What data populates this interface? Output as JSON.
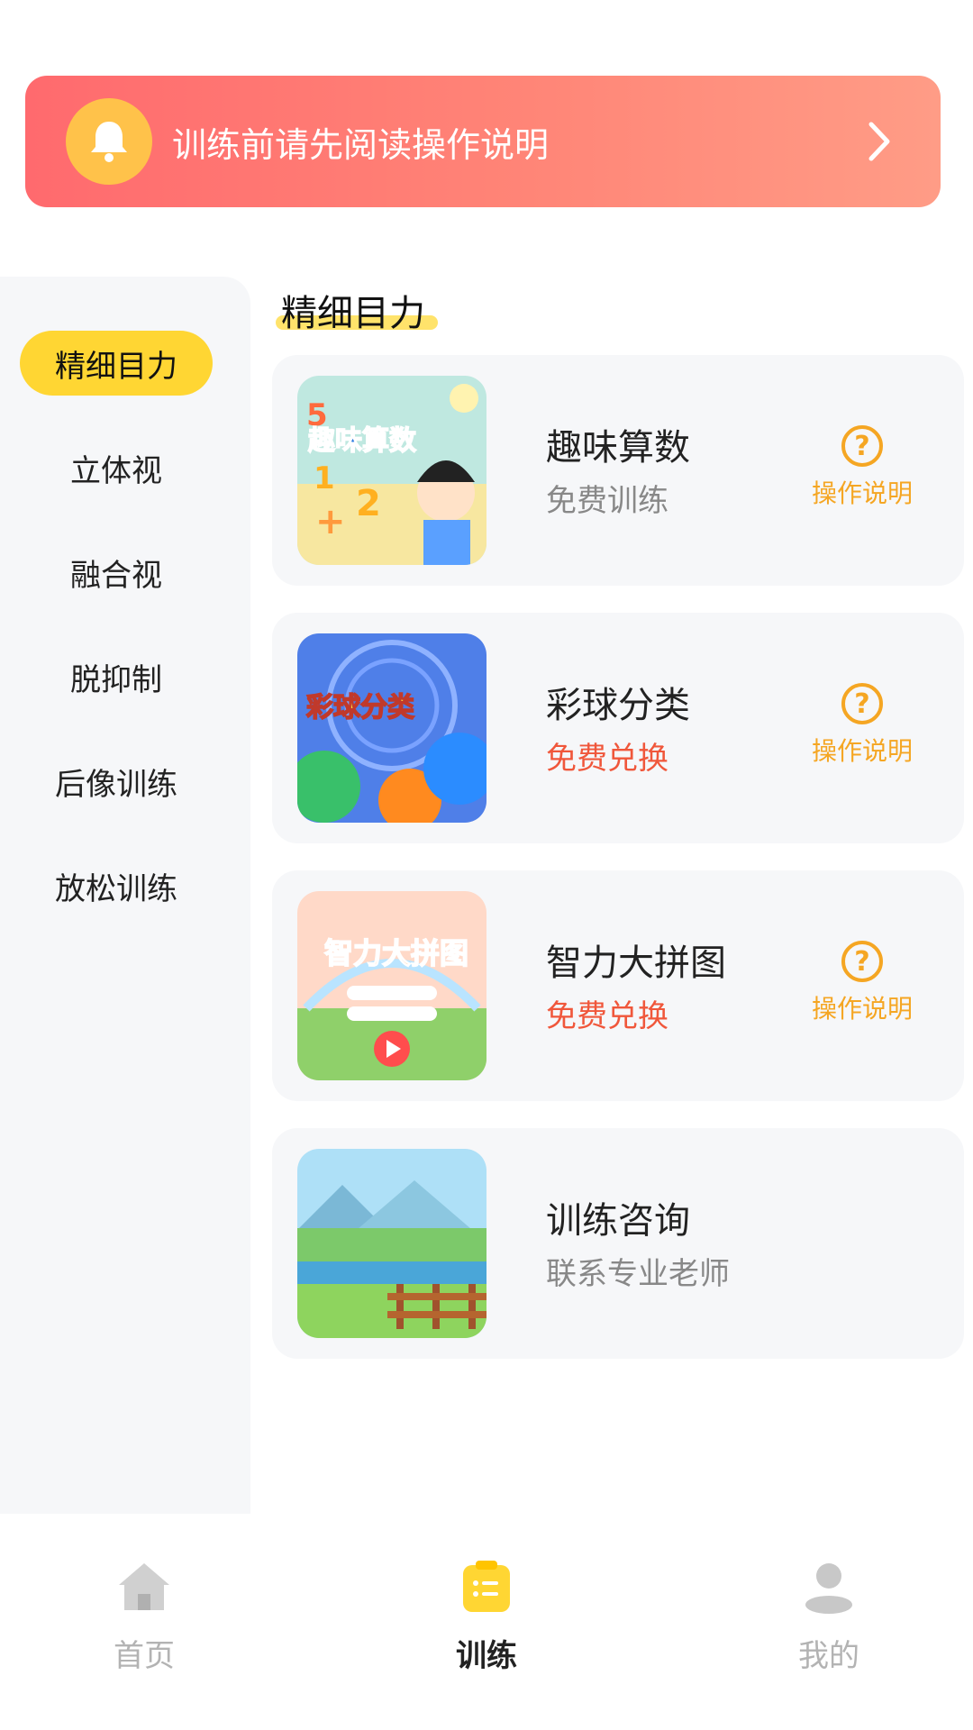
{
  "notice": {
    "text": "训练前请先阅读操作说明"
  },
  "sidebar": {
    "items": [
      {
        "label": "精细目力",
        "active": true
      },
      {
        "label": "立体视"
      },
      {
        "label": "融合视"
      },
      {
        "label": "脱抑制"
      },
      {
        "label": "后像训练"
      },
      {
        "label": "放松训练"
      }
    ]
  },
  "section": {
    "title": "精细目力"
  },
  "cards": [
    {
      "title": "趣味算数",
      "subtitle": "免费训练",
      "thumb_text": "趣味算数",
      "help_label": "操作说明"
    },
    {
      "title": "彩球分类",
      "subtitle": "免费兑换",
      "thumb_text": "彩球分类",
      "help_label": "操作说明"
    },
    {
      "title": "智力大拼图",
      "subtitle": "免费兑换",
      "thumb_text": "智力大拼图",
      "help_label": "操作说明"
    },
    {
      "title": "训练咨询",
      "subtitle": "联系专业老师"
    }
  ],
  "tabbar": {
    "items": [
      {
        "label": "首页",
        "icon": "home-icon"
      },
      {
        "label": "训练",
        "icon": "training-icon",
        "active": true
      },
      {
        "label": "我的",
        "icon": "user-icon"
      }
    ]
  },
  "colors": {
    "accent_yellow": "#ffd633",
    "banner_start": "#ff6a6e",
    "banner_end": "#ff9c86",
    "help_orange": "#f5a623",
    "redeem_red": "#f0573b"
  }
}
